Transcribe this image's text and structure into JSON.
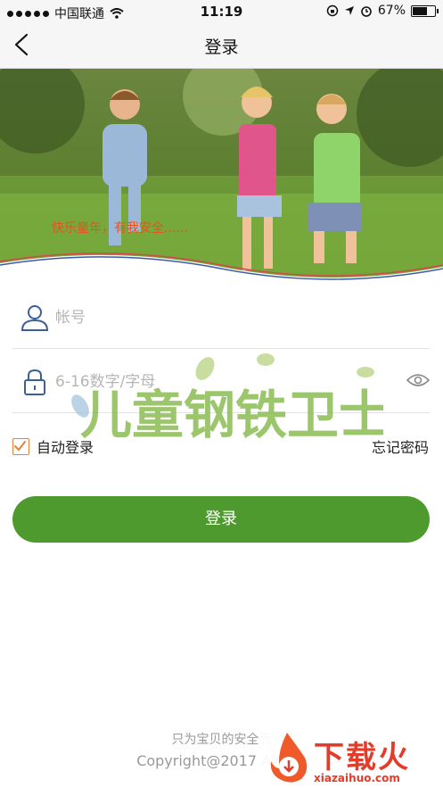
{
  "status_bar": {
    "carrier": "中国联通",
    "time": "11:19",
    "battery": "67%"
  },
  "nav": {
    "title": "登录"
  },
  "hero": {
    "slogan": "快乐童年，有我安全......"
  },
  "form": {
    "account_placeholder": "帐号",
    "password_placeholder": "6-16数字/字母",
    "remember_label": "自动登录",
    "remember_checked": true,
    "forgot_label": "忘记密码",
    "login_label": "登录"
  },
  "watermark": {
    "text": "儿童钢铁卫士"
  },
  "footer": {
    "line1": "只为宝贝的安全而",
    "line2": "Copyright@2017 All Rig"
  },
  "badge": {
    "text": "下载火",
    "url": "xiazaihuo.com"
  },
  "colors": {
    "primary": "#4f9a2f",
    "accent": "#e8521f",
    "checkbox": "#e8803a",
    "icon": "#3a5f9a"
  }
}
